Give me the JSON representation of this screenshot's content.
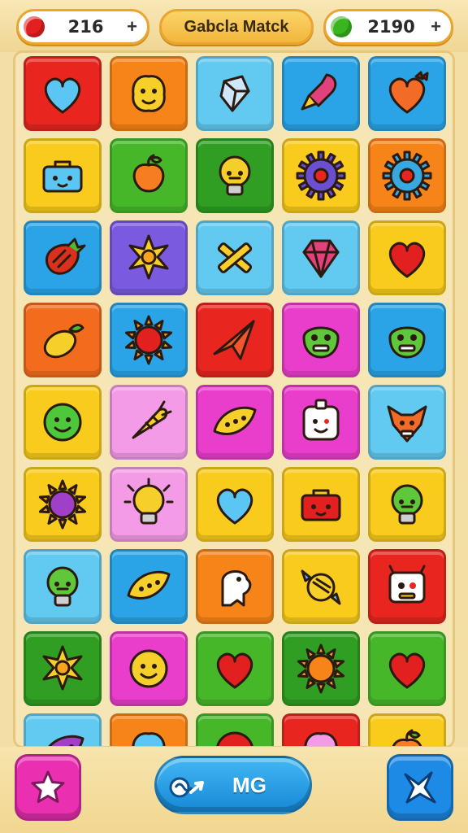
{
  "hud": {
    "left_counter": {
      "value": "216",
      "plus": "+",
      "orb_color": "#e32020"
    },
    "title": "Gabcla Matck",
    "right_counter": {
      "value": "2190",
      "plus": "+",
      "orb_color": "#39b51f"
    }
  },
  "board": {
    "tiles": [
      {
        "icon": "heart-icon",
        "bg": "#e8261f",
        "fg": "#5bc6f3"
      },
      {
        "icon": "blob-face-icon",
        "bg": "#f78419",
        "fg": "#f6cf2b"
      },
      {
        "icon": "crystal-icon",
        "bg": "#62c9f0",
        "fg": "#cfe7fb"
      },
      {
        "icon": "rocket-icon",
        "bg": "#2aa4e6",
        "fg": "#e2427c"
      },
      {
        "icon": "heart-bow-icon",
        "bg": "#2aa4e6",
        "fg": "#f26b27"
      },
      {
        "icon": "toolbox-icon",
        "bg": "#f8cb1d",
        "fg": "#5bc6f3"
      },
      {
        "icon": "peach-icon",
        "bg": "#47b72a",
        "fg": "#f57d22"
      },
      {
        "icon": "lightbulb-face-icon",
        "bg": "#2f9e22",
        "fg": "#f4cf2c"
      },
      {
        "icon": "gear-orb-icon",
        "bg": "#f8cb1d",
        "fg": "#6a4fd1"
      },
      {
        "icon": "gear-orb-icon",
        "bg": "#f78419",
        "fg": "#37a9e0"
      },
      {
        "icon": "strawberry-icon",
        "bg": "#2aa4e6",
        "fg": "#d9311e"
      },
      {
        "icon": "star-burst-icon",
        "bg": "#7a5be0",
        "fg": "#f6cf2b"
      },
      {
        "icon": "crossed-sticks-icon",
        "bg": "#62c9f0",
        "fg": "#f6cf2b"
      },
      {
        "icon": "gem-icon",
        "bg": "#62c9f0",
        "fg": "#e2427c"
      },
      {
        "icon": "heart-icon",
        "bg": "#f8cb1d",
        "fg": "#e32020"
      },
      {
        "icon": "lemon-leaf-icon",
        "bg": "#f36b1c",
        "fg": "#f6cf2b"
      },
      {
        "icon": "sun-icon",
        "bg": "#2aa4e6",
        "fg": "#e32020"
      },
      {
        "icon": "paper-plane-icon",
        "bg": "#e8261f",
        "fg": "#f2562c"
      },
      {
        "icon": "alien-face-icon",
        "bg": "#e93ecb",
        "fg": "#5fc83a"
      },
      {
        "icon": "alien-face-icon",
        "bg": "#2aa4e6",
        "fg": "#5fc83a"
      },
      {
        "icon": "smile-ball-icon",
        "bg": "#f8cb1d",
        "fg": "#4cc83a"
      },
      {
        "icon": "carrot-icon",
        "bg": "#f39be6",
        "fg": "#f6cf2b"
      },
      {
        "icon": "leaf-pod-icon",
        "bg": "#e93ecb",
        "fg": "#f6cf2b"
      },
      {
        "icon": "dice-face-icon",
        "bg": "#e93ecb",
        "fg": "#ffffff"
      },
      {
        "icon": "fox-face-icon",
        "bg": "#62c9f0",
        "fg": "#f26b27"
      },
      {
        "icon": "sun-icon",
        "bg": "#f8cb1d",
        "fg": "#a040c8"
      },
      {
        "icon": "lightbulb-icon",
        "bg": "#f39be6",
        "fg": "#f6cf2b"
      },
      {
        "icon": "heart-icon",
        "bg": "#f8cb1d",
        "fg": "#5bc6f3"
      },
      {
        "icon": "toolbox-icon",
        "bg": "#f8cb1d",
        "fg": "#e32020"
      },
      {
        "icon": "lightbulb-face-icon",
        "bg": "#f8cb1d",
        "fg": "#5fc83a"
      },
      {
        "icon": "lightbulb-face-icon",
        "bg": "#62c9f0",
        "fg": "#5fc83a"
      },
      {
        "icon": "leaf-pod-icon",
        "bg": "#2aa4e6",
        "fg": "#f6cf2b"
      },
      {
        "icon": "ghost-icon",
        "bg": "#f78419",
        "fg": "#ffffff"
      },
      {
        "icon": "candy-icon",
        "bg": "#f8cb1d",
        "fg": "#f6cf2b"
      },
      {
        "icon": "robot-face-icon",
        "bg": "#e8261f",
        "fg": "#ffffff"
      },
      {
        "icon": "star-burst-icon",
        "bg": "#2f9e22",
        "fg": "#f6cf2b"
      },
      {
        "icon": "smile-ball-icon",
        "bg": "#e93ecb",
        "fg": "#f6cf2b"
      },
      {
        "icon": "heart-icon",
        "bg": "#47b72a",
        "fg": "#e32020"
      },
      {
        "icon": "sun-icon",
        "bg": "#2f9e22",
        "fg": "#f78419"
      },
      {
        "icon": "heart-icon",
        "bg": "#47b72a",
        "fg": "#e32020"
      },
      {
        "icon": "leaf-pod-icon",
        "bg": "#62c9f0",
        "fg": "#a040c8"
      },
      {
        "icon": "blob-face-icon",
        "bg": "#f78419",
        "fg": "#5bc6f3"
      },
      {
        "icon": "smile-ball-icon",
        "bg": "#47b72a",
        "fg": "#e32020"
      },
      {
        "icon": "blob-face-icon",
        "bg": "#e8261f",
        "fg": "#f39be6"
      },
      {
        "icon": "peach-icon",
        "bg": "#f8cb1d",
        "fg": "#f57d22"
      }
    ]
  },
  "bottom": {
    "mode_label": "MG",
    "left_color": "#ea2fb0",
    "right_color": "#1d8ae6"
  }
}
